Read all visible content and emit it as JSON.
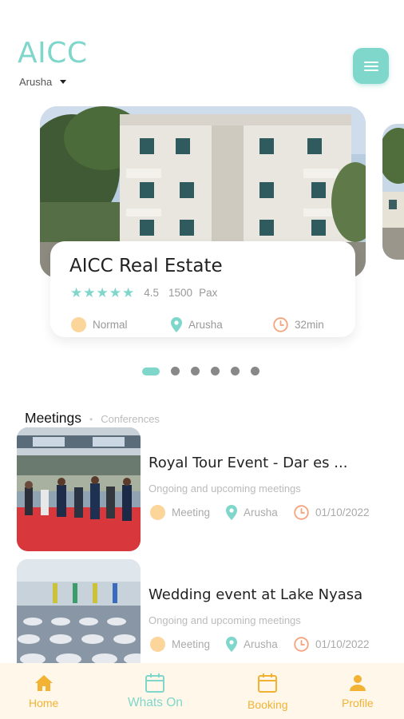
{
  "header": {
    "title": "AICC",
    "location": "Arusha"
  },
  "featured": {
    "title": "AICC Real Estate",
    "rating": "4.5",
    "capacity": "1500",
    "capacity_unit": "Pax",
    "stars": 5,
    "category": "Normal",
    "location": "Arusha",
    "duration": "32min"
  },
  "pager": {
    "count": 6,
    "active_index": 0
  },
  "section_tabs": {
    "meetings": "Meetings",
    "separator": "•",
    "conferences": "Conferences"
  },
  "events": [
    {
      "title": "Royal  Tour Event - Dar es ...",
      "subtitle": "Ongoing and upcoming meetings",
      "category": "Meeting",
      "location": "Arusha",
      "date": "01/10/2022"
    },
    {
      "title": "Wedding event at Lake Nyasa",
      "subtitle": "Ongoing and upcoming meetings",
      "category": "Meeting",
      "location": "Arusha",
      "date": "01/10/2022"
    }
  ],
  "bottom_nav": {
    "home": "Home",
    "whats_on": "Whats On",
    "booking": "Booking",
    "profile": "Profile"
  },
  "colors": {
    "accent": "#7fd6cb",
    "nav_active": "#f2b233",
    "nav_inactive_mint": "#7fd6cb",
    "clock_orange": "#f4a37a",
    "yellow_dot": "#fcd59a",
    "nav_bg": "#fff8ea"
  }
}
